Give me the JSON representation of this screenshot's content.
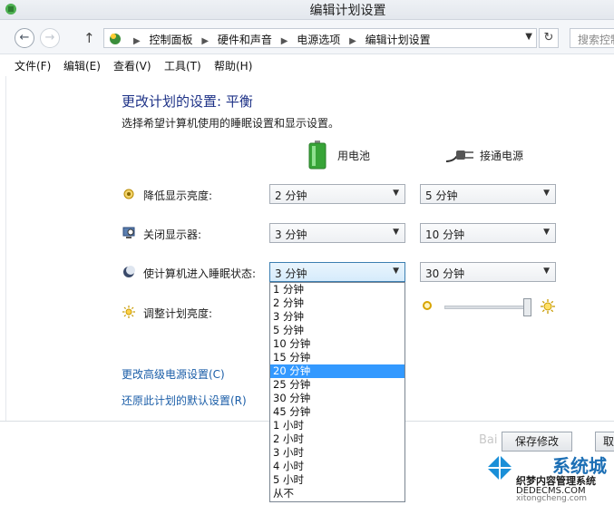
{
  "window": {
    "title": "编辑计划设置"
  },
  "address": {
    "crumbs": [
      "控制面板",
      "硬件和声音",
      "电源选项",
      "编辑计划设置"
    ],
    "search_placeholder": "搜索控制"
  },
  "menu": [
    "文件(F)",
    "编辑(E)",
    "查看(V)",
    "工具(T)",
    "帮助(H)"
  ],
  "page": {
    "heading": "更改计划的设置: 平衡",
    "subtext": "选择希望计算机使用的睡眠设置和显示设置。",
    "col_battery": "用电池",
    "col_plugged": "接通电源"
  },
  "rows": [
    {
      "label": "降低显示亮度:",
      "battery": "2 分钟",
      "plugged": "5 分钟",
      "icon": "dim-display-icon"
    },
    {
      "label": "关闭显示器:",
      "battery": "3 分钟",
      "plugged": "10 分钟",
      "icon": "monitor-icon"
    },
    {
      "label": "使计算机进入睡眠状态:",
      "battery": "3 分钟",
      "plugged": "30 分钟",
      "icon": "moon-icon"
    },
    {
      "label": "调整计划亮度:",
      "icon": "sun-icon"
    }
  ],
  "brightness_plugged_level": 100,
  "links": {
    "advanced": "更改高级电源设置(C)",
    "restore": "还原此计划的默认设置(R)"
  },
  "buttons": {
    "save": "保存修改",
    "cancel": "取"
  },
  "dropdown": {
    "options": [
      "1 分钟",
      "2 分钟",
      "3 分钟",
      "5 分钟",
      "10 分钟",
      "15 分钟",
      "20 分钟",
      "25 分钟",
      "30 分钟",
      "45 分钟",
      "1 小时",
      "2 小时",
      "3 小时",
      "4 小时",
      "5 小时",
      "从不"
    ],
    "highlighted": "20 分钟"
  },
  "watermark": {
    "line1": "系统城",
    "line2": "织梦内容管理系统",
    "line3": "DEDECMS.COM",
    "line4": "xitongcheng.com",
    "baidu": "Bai"
  },
  "colors": {
    "heading": "#1e3287",
    "link": "#1b5ea8",
    "highlight": "#3399ff"
  }
}
